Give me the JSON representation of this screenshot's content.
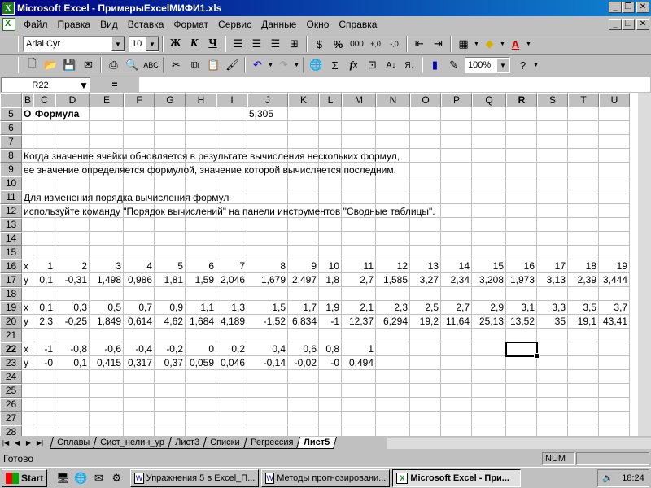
{
  "window": {
    "title": "Microsoft Excel - ПримерыExcelМИФИ1.xls",
    "app_icon_text": "X"
  },
  "menu": [
    "Файл",
    "Правка",
    "Вид",
    "Вставка",
    "Формат",
    "Сервис",
    "Данные",
    "Окно",
    "Справка"
  ],
  "toolbar": {
    "font": "Arial Cyr",
    "size": "10",
    "zoom": "100%"
  },
  "formula_bar": {
    "name_box": "R22",
    "eq": "="
  },
  "columns": [
    "B",
    "C",
    "D",
    "E",
    "F",
    "G",
    "H",
    "I",
    "J",
    "K",
    "L",
    "M",
    "N",
    "O",
    "P",
    "Q",
    "R",
    "S",
    "T",
    "U"
  ],
  "selected_column": "R",
  "rows": [
    "5",
    "6",
    "7",
    "8",
    "9",
    "10",
    "11",
    "12",
    "13",
    "14",
    "15",
    "16",
    "17",
    "18",
    "19",
    "20",
    "21",
    "22",
    "23",
    "24",
    "25",
    "26",
    "27",
    "28"
  ],
  "selected_row": "22",
  "cells": {
    "r5": {
      "b": "О",
      "c": "Формула",
      "j": "5,305"
    },
    "r16": [
      "x",
      "1",
      "2",
      "3",
      "4",
      "5",
      "6",
      "7",
      "8",
      "9",
      "10",
      "11",
      "12",
      "13",
      "14",
      "15",
      "16",
      "17",
      "18",
      "19"
    ],
    "r17": [
      "y",
      "0,1",
      "-0,31",
      "1,498",
      "0,986",
      "1,81",
      "1,59",
      "2,046",
      "1,679",
      "2,497",
      "1,8",
      "2,7",
      "1,585",
      "3,27",
      "2,34",
      "3,208",
      "1,973",
      "3,13",
      "2,39",
      "3,444"
    ],
    "r19": [
      "x",
      "0,1",
      "0,3",
      "0,5",
      "0,7",
      "0,9",
      "1,1",
      "1,3",
      "1,5",
      "1,7",
      "1,9",
      "2,1",
      "2,3",
      "2,5",
      "2,7",
      "2,9",
      "3,1",
      "3,3",
      "3,5",
      "3,7"
    ],
    "r20": [
      "y",
      "2,3",
      "-0,25",
      "1,849",
      "0,614",
      "4,62",
      "1,684",
      "4,189",
      "-1,52",
      "6,834",
      "-1",
      "12,37",
      "6,294",
      "19,2",
      "11,64",
      "25,13",
      "13,52",
      "35",
      "19,1",
      "43,41"
    ],
    "r22": [
      "x",
      "-1",
      "-0,8",
      "-0,6",
      "-0,4",
      "-0,2",
      "0",
      "0,2",
      "0,4",
      "0,6",
      "0,8",
      "1",
      "",
      "",
      "",
      "",
      "",
      "",
      "",
      ""
    ],
    "r23": [
      "y",
      "-0",
      "0,1",
      "0,415",
      "0,317",
      "0,37",
      "0,059",
      "0,046",
      "-0,14",
      "-0,02",
      "-0",
      "0,494",
      "",
      "",
      "",
      "",
      "",
      "",
      "",
      ""
    ]
  },
  "text_lines": {
    "r8": "Когда значение ячейки обновляется в результате вычисления нескольких формул,",
    "r9": "ее значение определяется формулой, значение которой вычисляется последним.",
    "r11": "Для изменения порядка вычисления формул",
    "r12": "используйте команду \"Порядок вычислений\" на панели инструментов \"Сводные таблицы\"."
  },
  "sheet_tabs": [
    "Сплавы",
    "Сист_нелин_ур",
    "Лист3",
    "Списки",
    "Регрессия",
    "Лист5"
  ],
  "active_tab": "Лист5",
  "status": {
    "text": "Готово",
    "num": "NUM"
  },
  "taskbar": {
    "start": "Start",
    "buttons": [
      {
        "label": "Упражнения 5 в Excel_П...",
        "icon": "W"
      },
      {
        "label": "Методы прогнозировани...",
        "icon": "W"
      },
      {
        "label": "Microsoft Excel - При...",
        "icon": "X"
      }
    ],
    "clock": "18:24"
  }
}
